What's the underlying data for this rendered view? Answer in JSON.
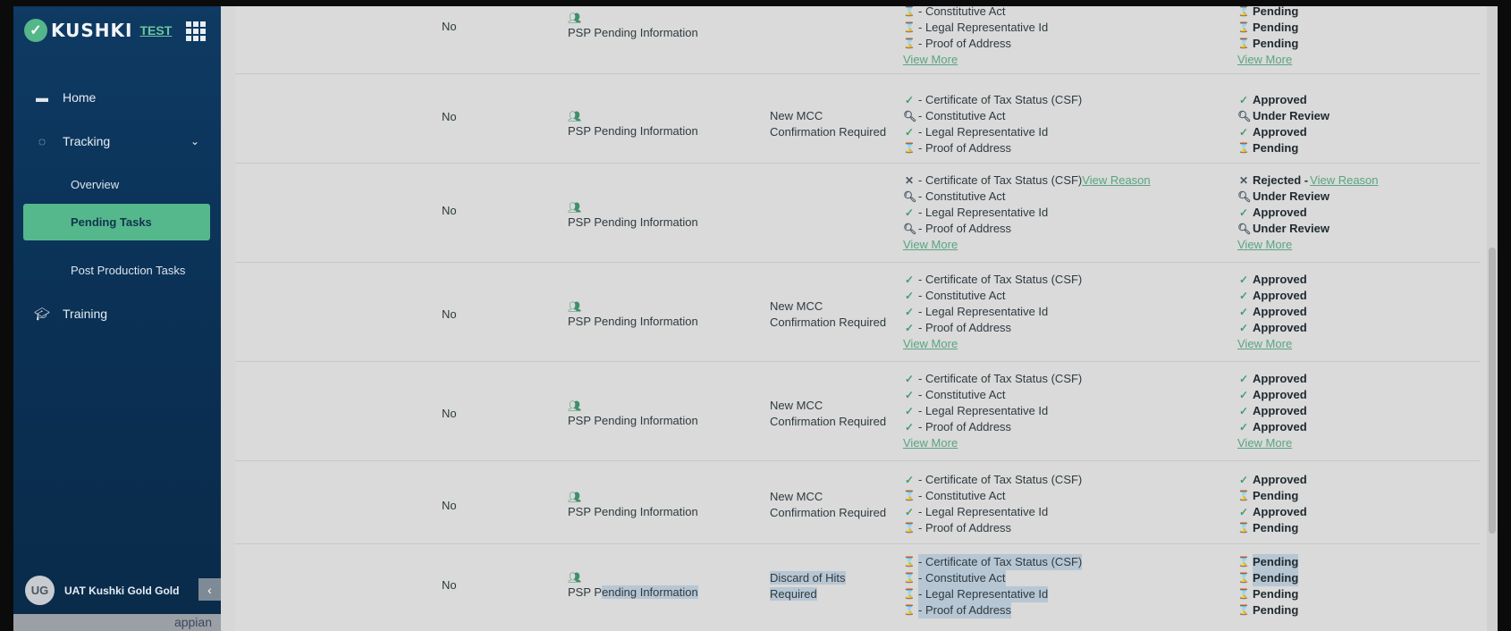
{
  "app": {
    "brand": "KUSHKI",
    "env_badge": "TEST",
    "footer_brand": "appian"
  },
  "sidebar": {
    "home": "Home",
    "tracking": "Tracking",
    "overview": "Overview",
    "pending_tasks": "Pending Tasks",
    "post_production": "Post Production Tasks",
    "training": "Training",
    "user_initials": "UG",
    "user_name": "UAT Kushki Gold Gold"
  },
  "labels": {
    "view_more": "View More",
    "view_reason": "View Reason"
  },
  "rows": [
    {
      "no": "No",
      "type": "PSP Pending Information",
      "reason_1": "",
      "reason_2": "",
      "docs": [
        "- Constitutive Act",
        "- Legal Representative Id",
        "- Proof of Address"
      ],
      "statuses": [
        "Pending",
        "Pending",
        "Pending"
      ]
    },
    {
      "no": "No",
      "type": "PSP Pending Information",
      "reason_1": "New MCC",
      "reason_2": "Confirmation Required",
      "docs": [
        "- Certificate of Tax Status (CSF)",
        "- Constitutive Act",
        "- Legal Representative Id",
        "- Proof of Address"
      ],
      "statuses": [
        "Approved",
        "Under Review",
        "Approved",
        "Pending"
      ]
    },
    {
      "no": "No",
      "type": "PSP Pending Information",
      "reason_1": "",
      "reason_2": "",
      "docs": [
        "- Certificate of Tax Status (CSF)",
        "- Constitutive Act",
        "- Legal Representative Id",
        "- Proof of Address"
      ],
      "statuses": [
        "Rejected -",
        "Under Review",
        "Approved",
        "Under Review"
      ]
    },
    {
      "no": "No",
      "type": "PSP Pending Information",
      "reason_1": "New MCC",
      "reason_2": "Confirmation Required",
      "docs": [
        "- Certificate of Tax Status (CSF)",
        "- Constitutive Act",
        "- Legal Representative Id",
        "- Proof of Address"
      ],
      "statuses": [
        "Approved",
        "Approved",
        "Approved",
        "Approved"
      ]
    },
    {
      "no": "No",
      "type": "PSP Pending Information",
      "reason_1": "New MCC",
      "reason_2": "Confirmation Required",
      "docs": [
        "- Certificate of Tax Status (CSF)",
        "- Constitutive Act",
        "- Legal Representative Id",
        "- Proof of Address"
      ],
      "statuses": [
        "Approved",
        "Approved",
        "Approved",
        "Approved"
      ]
    },
    {
      "no": "No",
      "type": "PSP Pending Information",
      "reason_1": "New MCC",
      "reason_2": "Confirmation Required",
      "docs": [
        "- Certificate of Tax Status (CSF)",
        "- Constitutive Act",
        "- Legal Representative Id",
        "- Proof of Address"
      ],
      "statuses": [
        "Approved",
        "Pending",
        "Approved",
        "Pending"
      ]
    },
    {
      "no": "No",
      "type_prefix": "PSP P",
      "type_rest": "ending Information",
      "reason_1": "Discard of Hits",
      "reason_2": "Required",
      "docs": [
        "- Certificate of Tax Status (CSF)",
        "- Constitutive Act",
        "- Legal Representative Id",
        "- Proof of Address"
      ],
      "statuses": [
        "Pending",
        "Pending",
        "Pending",
        "Pending"
      ]
    }
  ]
}
